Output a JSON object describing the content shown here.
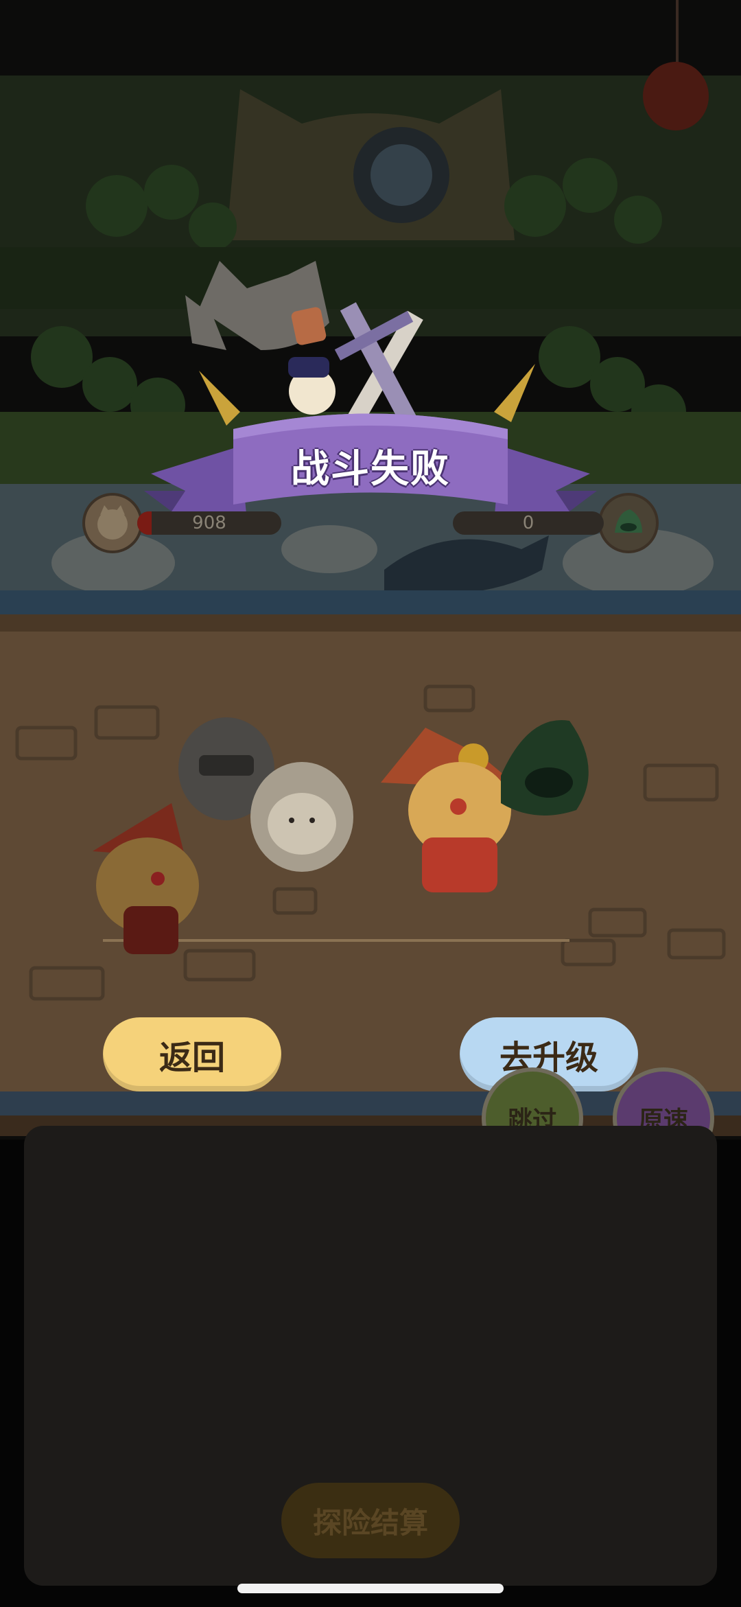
{
  "result": {
    "title": "战斗失败"
  },
  "player": {
    "hp": 908,
    "hp_fraction": 0.1
  },
  "enemy": {
    "hp": 0,
    "hp_fraction": 0.0
  },
  "actions": {
    "back_label": "返回",
    "upgrade_label": "去升级"
  },
  "speed_controls": {
    "skip_label": "跳过",
    "normal_speed_label": "原速"
  },
  "footer": {
    "settle_label": "探险结算"
  },
  "colors": {
    "back_button": "#f5d27a",
    "upgrade_button": "#b8d8f2",
    "skip_button": "#4d5d2c",
    "speed_button": "#5b3b6e",
    "ribbon": "#8e6cc0",
    "ground": "#5e4934"
  }
}
